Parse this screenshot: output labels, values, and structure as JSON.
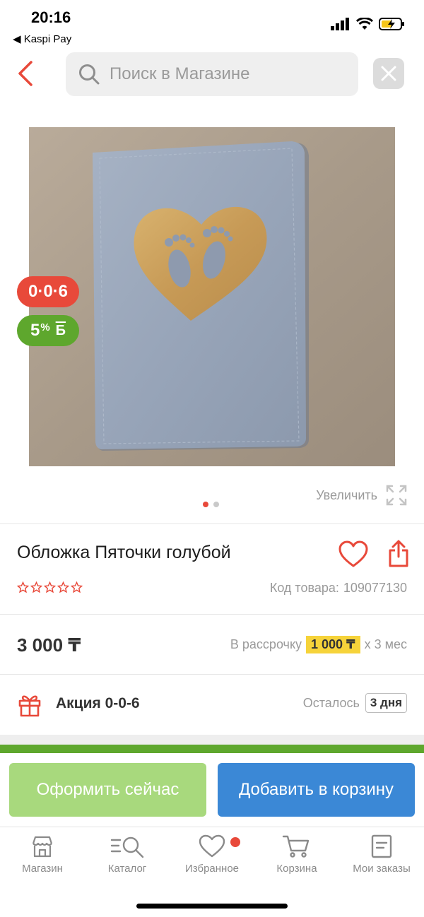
{
  "status_bar": {
    "time": "20:16",
    "back_app": "◀ Kaspi Pay"
  },
  "search": {
    "placeholder": "Поиск в Магазине"
  },
  "badges": {
    "credit": "0·0·6",
    "bonus_value": "5",
    "bonus_pct": "%",
    "bonus_symbol": "Б"
  },
  "gallery": {
    "zoom_label": "Увеличить",
    "pages": 2,
    "active_page": 1
  },
  "product": {
    "title": "Обложка Пяточки голубой",
    "rating_stars": 0,
    "sku_label": "Код товара:",
    "sku_value": "109077130",
    "price": "3 000 ₸"
  },
  "installment": {
    "prefix": "В рассрочку",
    "amount": "1 000 ₸",
    "suffix": "х 3 мес"
  },
  "promo": {
    "label": "Акция 0-0-6",
    "remaining_label": "Осталось",
    "remaining_value": "3 дня"
  },
  "actions": {
    "order_label": "Оформить сейчас",
    "cart_label": "Добавить в корзину"
  },
  "tabs": [
    {
      "label": "Магазин",
      "icon": "store-icon"
    },
    {
      "label": "Каталог",
      "icon": "catalog-icon"
    },
    {
      "label": "Избранное",
      "icon": "heart-icon"
    },
    {
      "label": "Корзина",
      "icon": "cart-icon"
    },
    {
      "label": "Мои заказы",
      "icon": "orders-icon"
    }
  ],
  "colors": {
    "accent_red": "#e8493a",
    "accent_green": "#5ea72d",
    "button_green": "#a8d97d",
    "button_blue": "#3b88d6",
    "highlight_yellow": "#f6d33a"
  }
}
